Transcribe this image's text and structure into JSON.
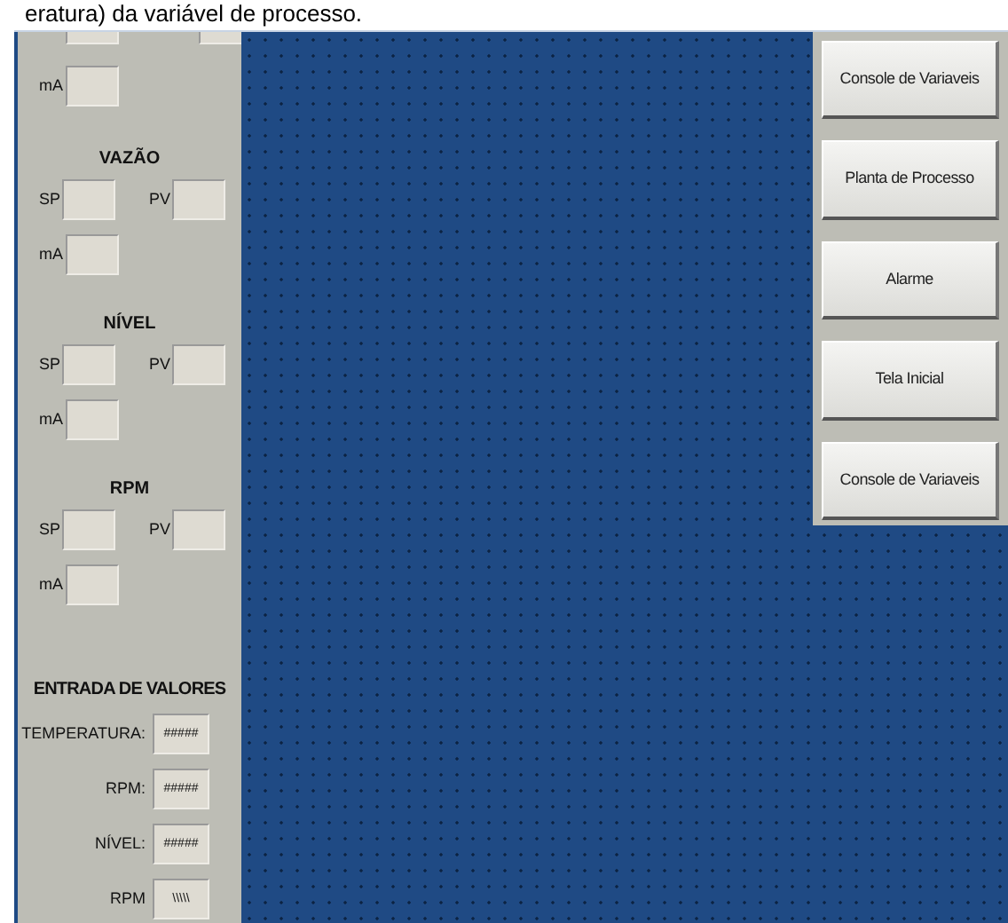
{
  "caption": "eratura) da variável de processo.",
  "top_section": {
    "ma_label": "mA"
  },
  "sections": [
    {
      "title": "VAZÃO",
      "sp_label": "SP",
      "pv_label": "PV",
      "ma_label": "mA"
    },
    {
      "title": "NÍVEL",
      "sp_label": "SP",
      "pv_label": "PV",
      "ma_label": "mA"
    },
    {
      "title": "RPM",
      "sp_label": "SP",
      "pv_label": "PV",
      "ma_label": "mA"
    }
  ],
  "entry": {
    "title": "ENTRADA DE VALORES",
    "rows": [
      {
        "label": "TEMPERATURA:",
        "value": "#####"
      },
      {
        "label": "RPM:",
        "value": "#####"
      },
      {
        "label": "NÍVEL:",
        "value": "#####"
      },
      {
        "label": "RPM",
        "value": "\\\\\\\\\\"
      }
    ]
  },
  "buttons": [
    "Console de Variaveis",
    "Planta de Processo",
    "Alarme",
    "Tela Inicial",
    "Console de Variaveis"
  ]
}
